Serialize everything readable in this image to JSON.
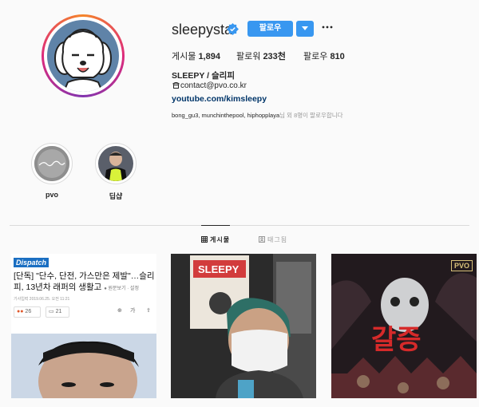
{
  "profile": {
    "username": "sleepysta",
    "follow_label": "팔로우",
    "stats": [
      {
        "label": "게시물",
        "value": "1,894"
      },
      {
        "label": "팔로워",
        "value": "233천"
      },
      {
        "label": "팔로우",
        "value": "810"
      }
    ],
    "display_name": "SLEEPY / 슬리피",
    "contact": "contact@pvo.co.kr",
    "link": "youtube.com/kimsleepy",
    "followed_by_names": "bong_gu3, munchinthepool, hiphopplaya",
    "followed_by_suffix": "님 외 8명이 팔로우합니다"
  },
  "highlights": [
    {
      "label": "pvo"
    },
    {
      "label": "딥샵"
    }
  ],
  "tabs": [
    {
      "label": "게시물",
      "active": true
    },
    {
      "label": "태그됨",
      "active": false
    }
  ],
  "posts": {
    "news": {
      "brand": "Dispatch",
      "headline": "[단독] \"단수, 단전, 가스만은 제발\"…슬리피, 13년차 래퍼의 생활고",
      "source": "● 원문보기 · 설정",
      "meta": "기사입력 2019.06.25. 오전 11:21",
      "reaction_count": "26",
      "comment_count": "21",
      "font_label": "가"
    },
    "poster_text": "SLEEPY",
    "album_text": "갈증",
    "album_logo": "PVO"
  },
  "colors": {
    "accent": "#3897f0",
    "link": "#003569",
    "verified": "#3897f0"
  }
}
